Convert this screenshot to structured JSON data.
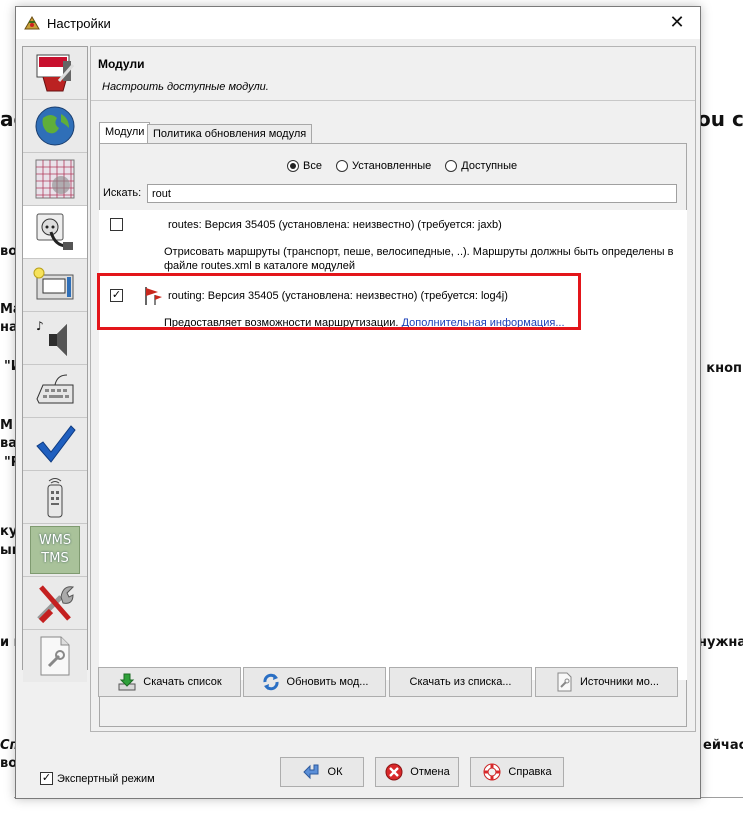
{
  "background": {
    "fragments": [
      "ac",
      "ou c",
      "во",
      "Ма",
      "на",
      "\"И",
      "на кноп",
      "М",
      "ва",
      "\"Р",
      "ку",
      "ык",
      "и п",
      "нужна",
      "Спр",
      "во",
      "ейчас"
    ]
  },
  "dialog": {
    "title": "Настройки",
    "close_glyph": "✕"
  },
  "sidebar": {
    "items": [
      {
        "icon": "paint-palette-icon"
      },
      {
        "icon": "globe-icon"
      },
      {
        "icon": "grid-map-icon"
      },
      {
        "icon": "plug-icon"
      },
      {
        "icon": "windows-icon"
      },
      {
        "icon": "speaker-icon"
      },
      {
        "icon": "keyboard-icon"
      },
      {
        "icon": "checkmark-icon"
      },
      {
        "icon": "remote-control-icon"
      },
      {
        "icon": "wms-tms-icon",
        "label_top": "WMS",
        "label_bottom": "TMS"
      },
      {
        "icon": "tools-icon"
      },
      {
        "icon": "document-wrench-icon"
      }
    ]
  },
  "header": {
    "title": "Модули",
    "subtitle": "Настроить доступные модули."
  },
  "tabs": [
    {
      "label": "Модули",
      "active": true
    },
    {
      "label": "Политика обновления модуля",
      "active": false
    }
  ],
  "filter": {
    "options": [
      "Все",
      "Установленные",
      "Доступные"
    ],
    "selected": "Все"
  },
  "search": {
    "label": "Искать:",
    "value": "rout"
  },
  "plugins": [
    {
      "title": "routes: Версия 35405 (установлена: неизвестно) (требуется: jaxb)",
      "description": "Отрисовать маршруты (транспорт, пеше, велосипедные, ..). Маршруты должны быть определены в файле routes.xml в каталоге модулей",
      "checked": false
    },
    {
      "title": "routing: Версия 35405 (установлена: неизвестно) (требуется: log4j)",
      "description": "Предоставляет возможности маршрутизации.",
      "link": "Дополнительная информация...",
      "checked": true
    }
  ],
  "actions": [
    {
      "label": "Скачать список",
      "icon": "download-icon"
    },
    {
      "label": "Обновить мод...",
      "icon": "refresh-icon"
    },
    {
      "label": "Скачать из списка...",
      "icon": ""
    },
    {
      "label": "Источники мо...",
      "icon": "document-wrench-icon"
    }
  ],
  "footer": {
    "expert_label": "Экспертный режим",
    "expert_checked": true,
    "ok_label": "ОК",
    "cancel_label": "Отмена",
    "help_label": "Справка"
  },
  "colors": {
    "highlight": "#e3151a",
    "link": "#1a3fb8"
  }
}
